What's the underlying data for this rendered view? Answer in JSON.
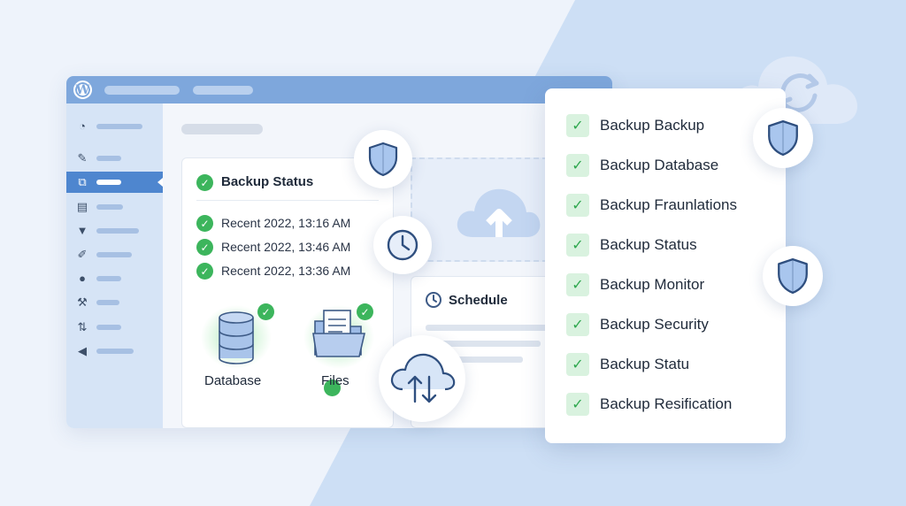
{
  "window": {
    "logo_letter": "W"
  },
  "status_card": {
    "title": "Backup Status",
    "recent": [
      "Recent 2022, 13:16 AM",
      "Recent 2022, 13:46 AM",
      "Recent 2022, 13:36 AM"
    ],
    "tiles": [
      {
        "label": "Database",
        "icon": "database-icon"
      },
      {
        "label": "Files",
        "icon": "folder-icon"
      }
    ]
  },
  "schedule": {
    "title": "Schedule"
  },
  "checklist": {
    "items": [
      "Backup Backup",
      "Backup Database",
      "Backup Fraunlations",
      "Backup Status",
      "Backup Monitor",
      "Backup Security",
      "Backup Statu",
      "Backup Resification"
    ]
  },
  "colors": {
    "accent": "#4e86cf",
    "titlebar": "#7ea7dc",
    "sidebar": "#d6e4f6",
    "success": "#3cb55c",
    "background": "#eef3fb"
  }
}
